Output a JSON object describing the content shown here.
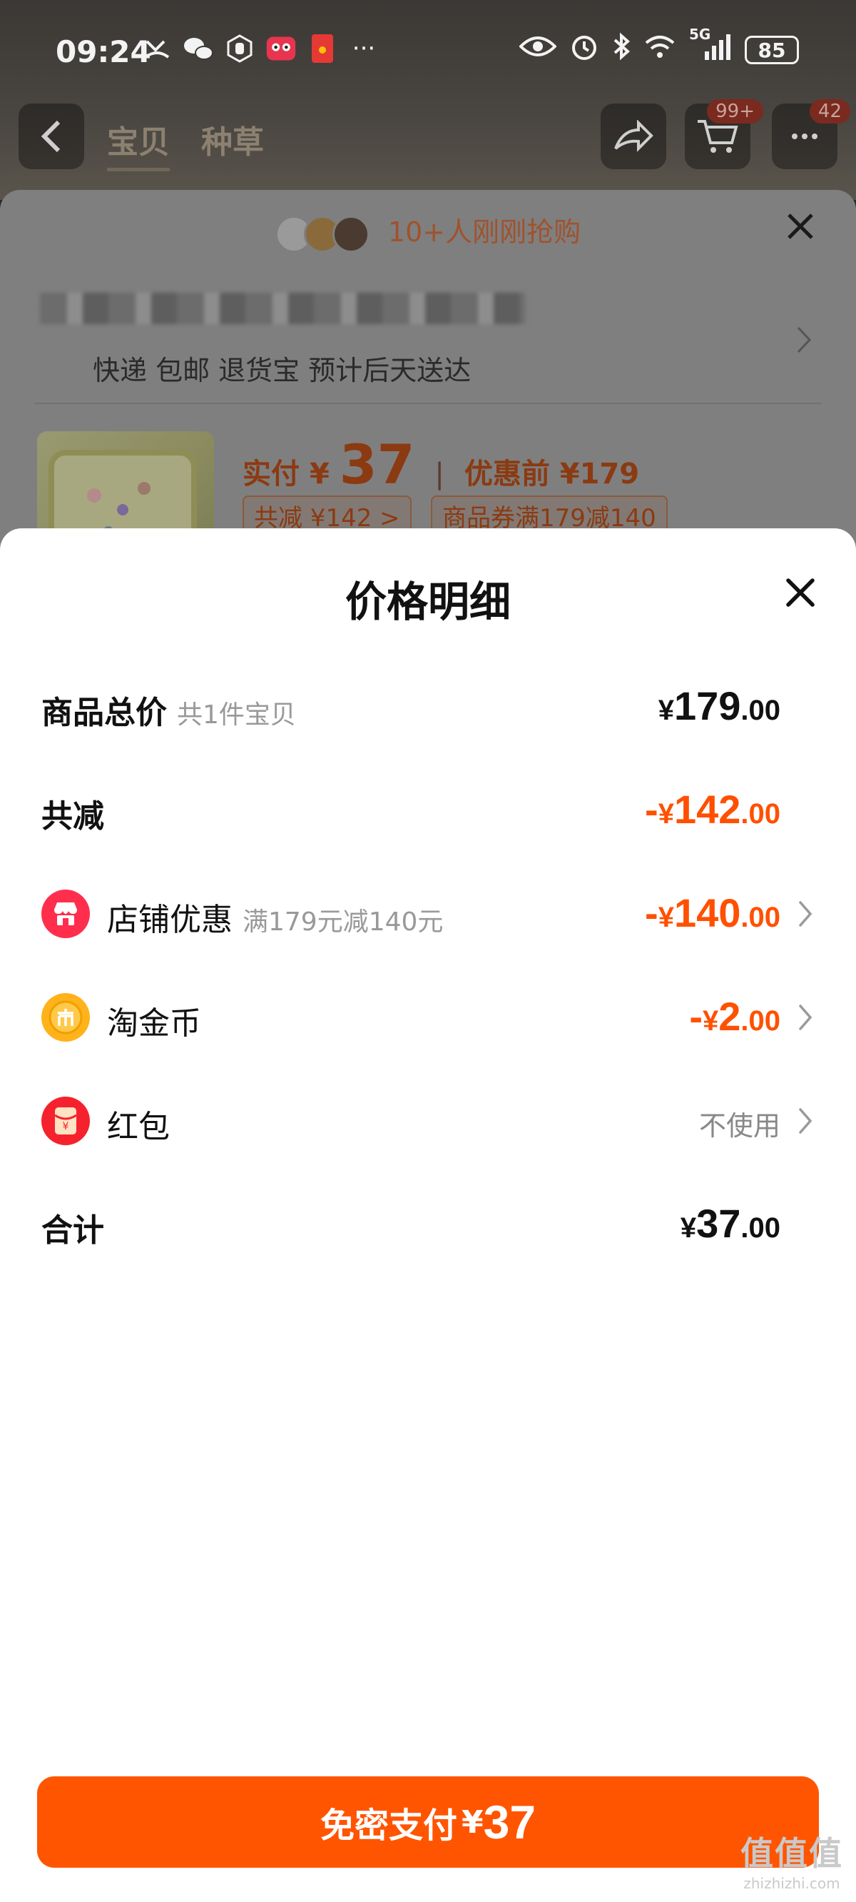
{
  "status_bar": {
    "time": "09:24",
    "battery": "85",
    "network": "5G",
    "more": "···"
  },
  "nav": {
    "tabs": [
      "宝贝",
      "种草"
    ],
    "cart_badge": "99+",
    "message_badge": "42"
  },
  "background_sheet": {
    "buyers_text": "10+人刚刚抢购",
    "shipping": "快递 包邮 退货宝 预计后天送达",
    "paid_label": "实付",
    "paid_currency": "¥",
    "paid_amount": "37",
    "original_price": "优惠前 ¥179",
    "tag_discount": "共减 ¥142 >",
    "tag_coupon": "商品券满179减140"
  },
  "panel": {
    "title": "价格明细",
    "rows": [
      {
        "label": "商品总价",
        "sub": "共1件宝贝",
        "sign": "",
        "currency": "¥",
        "int": "179",
        "dec": ".00"
      },
      {
        "label": "共减",
        "sign": "-",
        "currency": "¥",
        "int": "142",
        "dec": ".00"
      },
      {
        "label": "店铺优惠",
        "sub": "满179元减140元",
        "sign": "-",
        "currency": "¥",
        "int": "140",
        "dec": ".00",
        "icon": "shop-icon"
      },
      {
        "label": "淘金币",
        "sign": "-",
        "currency": "¥",
        "int": "2",
        "dec": ".00",
        "icon": "coin-icon"
      },
      {
        "label": "红包",
        "value": "不使用",
        "icon": "red-packet-icon"
      },
      {
        "label": "合计",
        "currency": "¥",
        "int": "37",
        "dec": ".00"
      }
    ]
  },
  "pay_button": {
    "label": "免密支付",
    "currency": "¥",
    "amount": "37"
  },
  "watermark": {
    "line1": "值值值",
    "line2": "zhizhizhi.com"
  },
  "colors": {
    "accent": "#ff5000",
    "button": "#ff5500"
  }
}
